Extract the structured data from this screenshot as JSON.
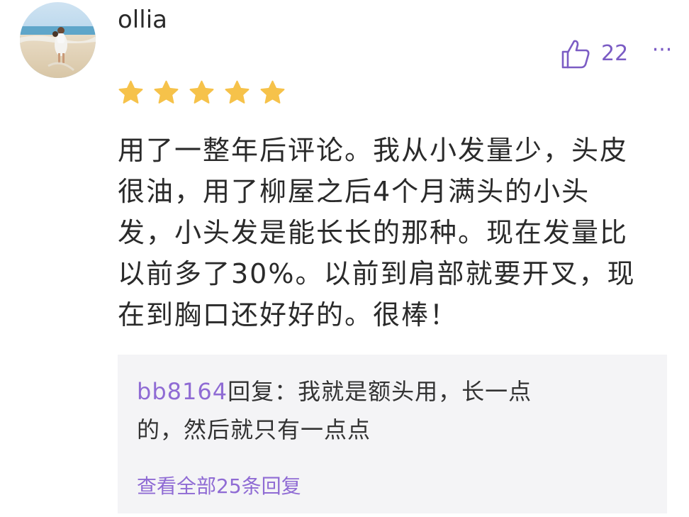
{
  "comment": {
    "username": "ollia",
    "avatar_icon": "avatar-photo-beach",
    "like_icon": "thumbs-up-icon",
    "like_count": "22",
    "more_icon": "more-dots-icon",
    "more_label": "···",
    "rating": 5,
    "rating_max": 5,
    "star_color": "#f6c24a",
    "text": "用了一整年后评论。我从小发量少，头皮\n很油，用了柳屋之后4个月满头的小头\n发，小头发是能长长的那种。现在发量比\n以前多了30%。以前到肩部就要开叉，现\n在到胸口还好好的。很棒！"
  },
  "reply": {
    "user": "bb8164",
    "reply_label": "回复：",
    "text": "我就是额头用，长一点\n的，然后就只有一点点",
    "view_all": "查看全部25条回复"
  },
  "colors": {
    "accent": "#8f6bd4",
    "reply_bg": "#f4f4f6",
    "text": "#2a2a2a"
  }
}
